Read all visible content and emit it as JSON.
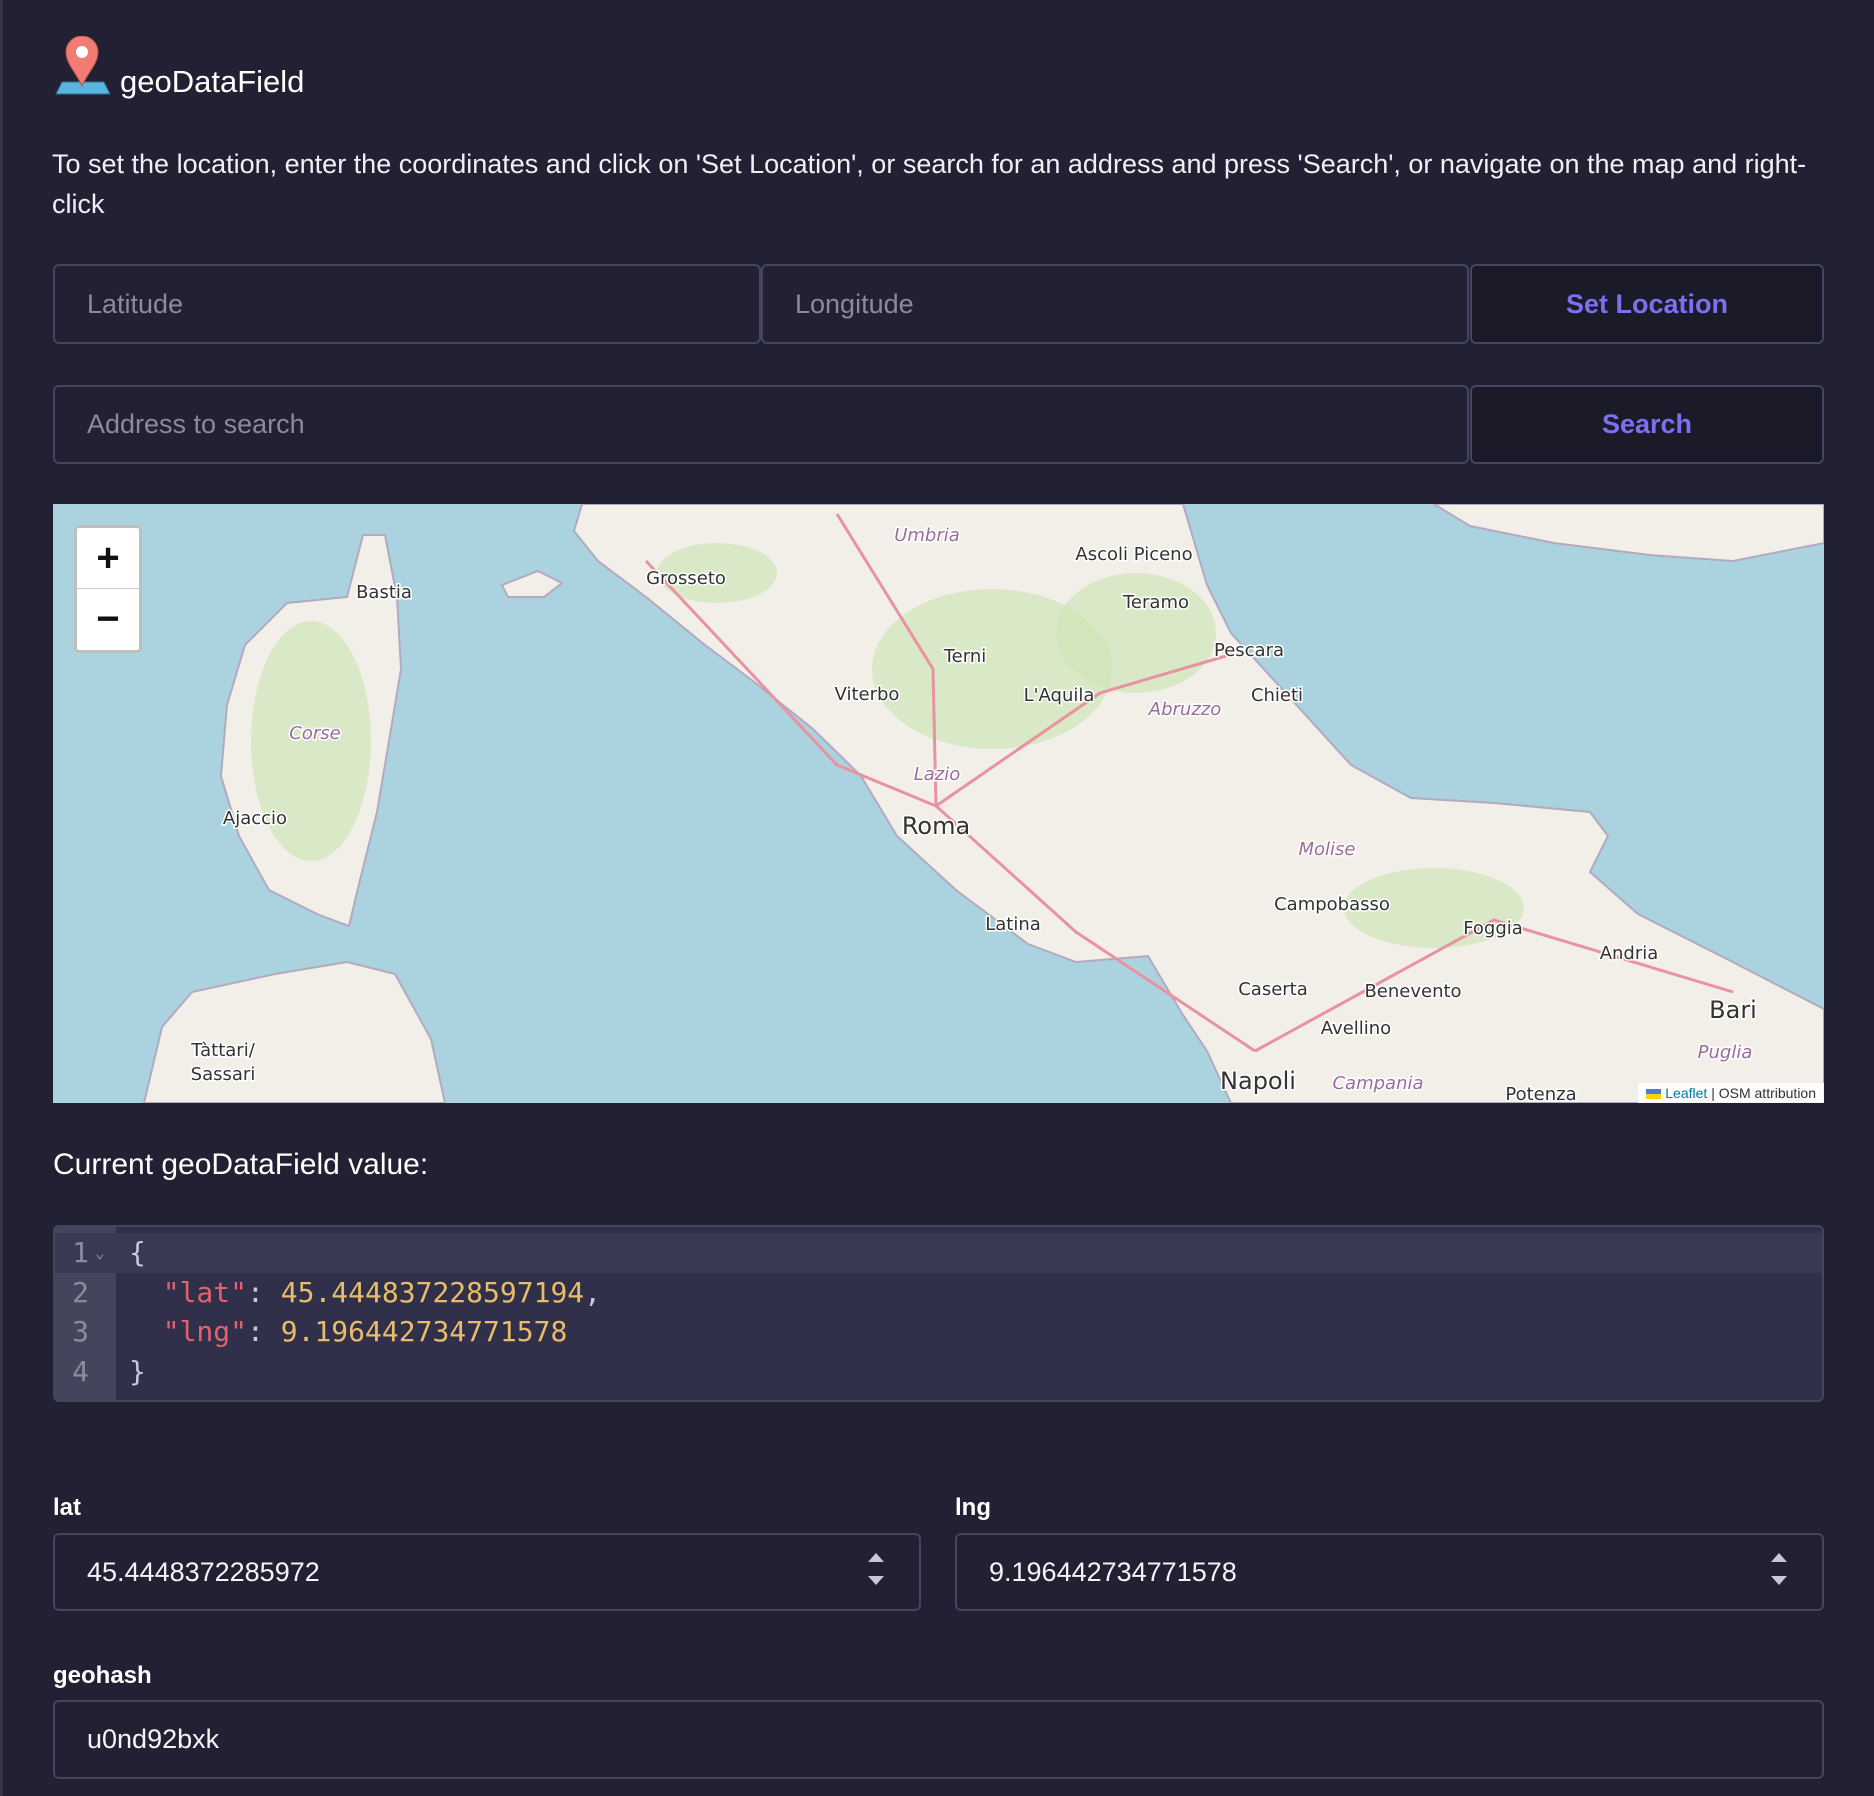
{
  "header": {
    "title": "geoDataField",
    "icon": "map-pin-icon",
    "pin_color": "#f07c74",
    "base_color": "#5ab4e0"
  },
  "description": "To set the location, enter the coordinates and click on 'Set Location', or search for an address and press 'Search', or navigate on the map and right-click",
  "coords": {
    "lat_placeholder": "Latitude",
    "lng_placeholder": "Longitude",
    "set_label": "Set Location"
  },
  "search": {
    "placeholder": "Address to search",
    "button_label": "Search"
  },
  "map": {
    "zoom_in": "+",
    "zoom_out": "−",
    "attribution_link": "Leaflet",
    "attribution_sep": "|",
    "attribution_text": "OSM attribution",
    "labels": [
      "Umbria",
      "Ascoli Piceno",
      "Grosseto",
      "Bastia",
      "Teramo",
      "Terni",
      "Pescara",
      "Viterbo",
      "L'Aquila",
      "Abruzzo",
      "Chieti",
      "Corse",
      "Lazio",
      "Ajaccio",
      "Roma",
      "Molise",
      "Campobasso",
      "Foggia",
      "Latina",
      "Andria",
      "Caserta",
      "Benevento",
      "Bari",
      "Avellino",
      "Tàttari/",
      "Sassari",
      "Puglia",
      "Napoli",
      "Campania",
      "Potenza"
    ],
    "sea_color": "#aad3df",
    "land_color": "#f2efe9"
  },
  "current": {
    "heading": "Current geoDataField value:",
    "lines": [
      {
        "n": "1",
        "open": "{"
      },
      {
        "n": "2",
        "key": "\"lat\"",
        "sep": ": ",
        "value": "45.444837228597194",
        "trail": ","
      },
      {
        "n": "3",
        "key": "\"lng\"",
        "sep": ": ",
        "value": "9.196442734771578",
        "trail": ""
      },
      {
        "n": "4",
        "open": "}"
      }
    ]
  },
  "fields": {
    "lat_label": "lat",
    "lat_value": "45.4448372285972",
    "lng_label": "lng",
    "lng_value": "9.196442734771578",
    "geohash_label": "geohash",
    "geohash_value": "u0nd92bxk"
  }
}
